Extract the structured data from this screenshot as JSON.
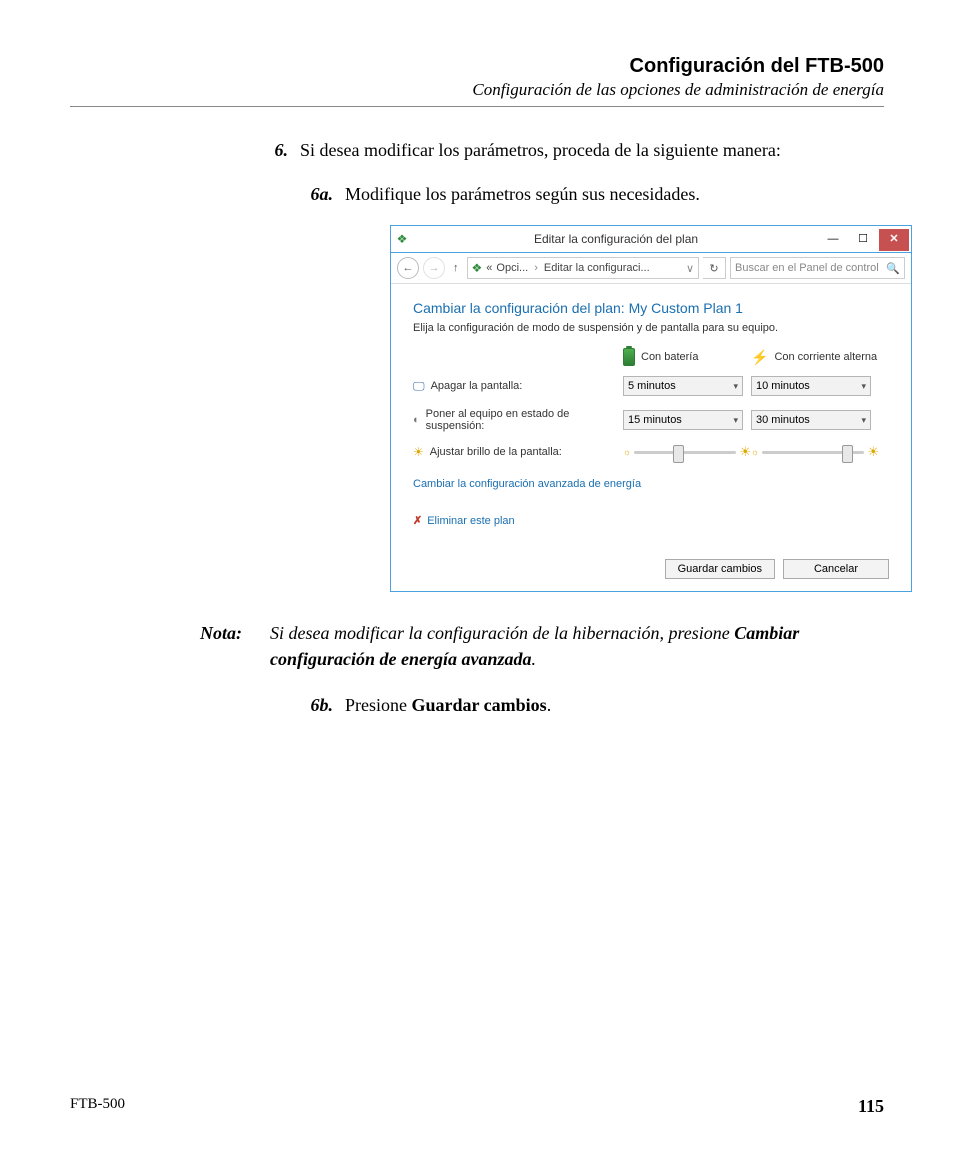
{
  "header": {
    "title": "Configuración del FTB-500",
    "subtitle": "Configuración de las opciones de administración de energía"
  },
  "steps": {
    "s6_num": "6.",
    "s6_text": "Si desea modificar los parámetros, proceda de la siguiente manera:",
    "s6a_num": "6a.",
    "s6a_text": "Modifique los parámetros según sus necesidades.",
    "s6b_num": "6b.",
    "s6b_pre": "Presione ",
    "s6b_bold": "Guardar cambios",
    "s6b_post": "."
  },
  "note": {
    "label": "Nota:",
    "pre": "Si desea modificar la configuración de la hibernación, presione ",
    "bold": "Cambiar configuración de energía avanzada",
    "post": "."
  },
  "win": {
    "title": "Editar la configuración del plan",
    "breadcrumb1": "Opci...",
    "breadcrumb2": "Editar la configuraci...",
    "search_placeholder": "Buscar en el Panel de control",
    "plan_title": "Cambiar la configuración del plan: My Custom Plan 1",
    "plan_desc": "Elija la configuración de modo de suspensión y de pantalla para su equipo.",
    "col_battery": "Con batería",
    "col_ac": "Con corriente alterna",
    "row_display": "Apagar la pantalla:",
    "row_sleep": "Poner al equipo en estado de suspensión:",
    "row_bright": "Ajustar brillo de la pantalla:",
    "display_battery": "5 minutos",
    "display_ac": "10 minutos",
    "sleep_battery": "15 minutos",
    "sleep_ac": "30 minutos",
    "adv_link": "Cambiar la configuración avanzada de energía",
    "del_link": "Eliminar este plan",
    "btn_save": "Guardar cambios",
    "btn_cancel": "Cancelar"
  },
  "footer": {
    "model": "FTB-500",
    "page": "115"
  }
}
